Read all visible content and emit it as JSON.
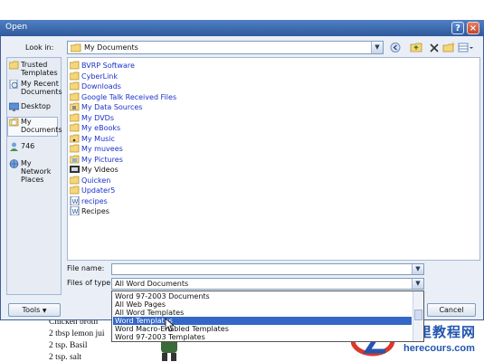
{
  "dialog": {
    "title": "Open",
    "help_label": "?",
    "close_label": "×"
  },
  "lookin": {
    "label": "Look in:",
    "value": "My Documents",
    "arrow": "▼"
  },
  "toolbar": {
    "back_icon": "back-icon",
    "up_icon": "up-folder-icon",
    "delete_icon": "delete-icon",
    "newfolder_icon": "new-folder-icon",
    "views_icon": "views-icon"
  },
  "places": [
    {
      "label": "Trusted Templates"
    },
    {
      "label": "My Recent Documents"
    },
    {
      "label": "Desktop"
    },
    {
      "label": "My Documents"
    },
    {
      "label": "746"
    },
    {
      "label": "My Network Places"
    }
  ],
  "files": [
    {
      "name": "BVRP Software"
    },
    {
      "name": "CyberLink"
    },
    {
      "name": "Downloads"
    },
    {
      "name": "Google Talk Received Files"
    },
    {
      "name": "My Data Sources"
    },
    {
      "name": "My DVDs"
    },
    {
      "name": "My eBooks"
    },
    {
      "name": "My Music"
    },
    {
      "name": "My muvees"
    },
    {
      "name": "My Pictures"
    },
    {
      "name": "My Videos"
    },
    {
      "name": "Quicken"
    },
    {
      "name": "Updater5"
    },
    {
      "name": "recipes"
    },
    {
      "name": "Recipes"
    }
  ],
  "filename": {
    "label": "File name:",
    "value": ""
  },
  "filetype": {
    "label": "Files of type:",
    "value": "All Word Documents",
    "options": [
      "Word 97-2003 Documents",
      "All Web Pages",
      "All Word Templates",
      "Word Templates",
      "Word Macro-Enabled Templates",
      "Word 97-2003 Templates"
    ],
    "selected_index": 3
  },
  "buttons": {
    "tools": "Tools",
    "cancel": "Cancel"
  },
  "background_doc": {
    "lines": [
      "Chicken broth",
      "2 tbsp lemon jui",
      "2 tsp. Basil",
      "2 tsp. salt"
    ]
  },
  "watermark": {
    "title": "这里教程网",
    "url": "herecours.com"
  },
  "colors": {
    "titlebar": "#2f5a9c",
    "selection": "#3467c8",
    "link": "#1a33c8"
  }
}
